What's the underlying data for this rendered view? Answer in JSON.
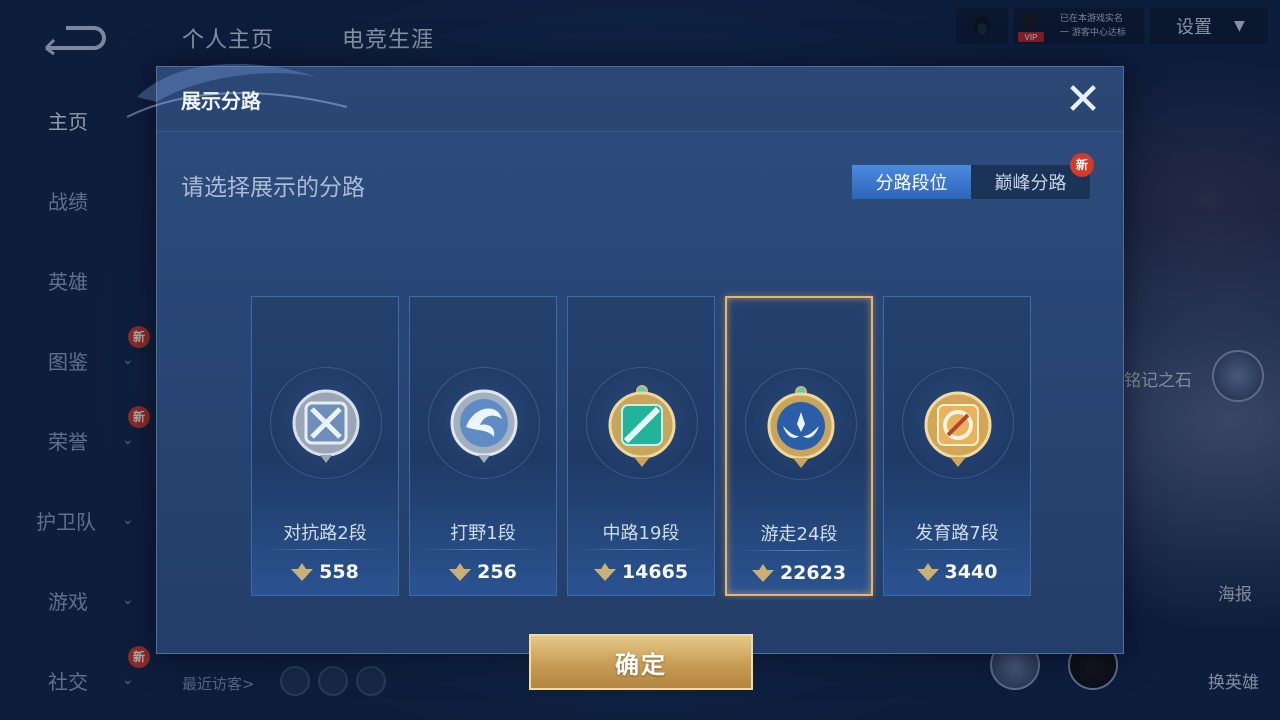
{
  "top_tabs": [
    "个人主页",
    "电竞生涯"
  ],
  "header": {
    "vip_text": "已在本游戏实名\n一 游客中心达标",
    "vip_badge": "VIP",
    "settings_label": "设置"
  },
  "sidebar": {
    "items": [
      {
        "label": "主页",
        "active": true,
        "chevron": false,
        "new": false
      },
      {
        "label": "战绩",
        "active": false,
        "chevron": false,
        "new": false
      },
      {
        "label": "英雄",
        "active": false,
        "chevron": false,
        "new": false
      },
      {
        "label": "图鉴",
        "active": false,
        "chevron": true,
        "new": true
      },
      {
        "label": "荣誉",
        "active": false,
        "chevron": true,
        "new": true
      },
      {
        "label": "护卫队",
        "active": false,
        "chevron": true,
        "new": false
      },
      {
        "label": "游戏",
        "active": false,
        "chevron": true,
        "new": false
      },
      {
        "label": "社交",
        "active": false,
        "chevron": true,
        "new": true
      }
    ],
    "new_badge": "新"
  },
  "right_panel": {
    "stone_label": "铭记之石",
    "poster_label": "海报",
    "switch_hero_label": "换英雄"
  },
  "visitors_label": "最近访客>",
  "dialog": {
    "title": "展示分路",
    "prompt": "请选择展示的分路",
    "toggle": {
      "options": [
        "分路段位",
        "巅峰分路"
      ],
      "active_index": 0,
      "new_badge": "新"
    },
    "cards": [
      {
        "rank": "对抗路2段",
        "score": "558",
        "emblem": "crossed-swords-emblem",
        "selected": false
      },
      {
        "rank": "打野1段",
        "score": "256",
        "emblem": "dragon-emblem",
        "selected": false
      },
      {
        "rank": "中路19段",
        "score": "14665",
        "emblem": "mage-slash-emblem",
        "selected": false
      },
      {
        "rank": "游走24段",
        "score": "22623",
        "emblem": "winged-star-emblem",
        "selected": true
      },
      {
        "rank": "发育路7段",
        "score": "3440",
        "emblem": "marksman-emblem",
        "selected": false
      }
    ],
    "confirm_label": "确定"
  },
  "colors": {
    "accent_blue": "#3d7bd0",
    "gold": "#d4a860",
    "selected_border": "#e8b36a",
    "badge_red": "#d23a2a"
  }
}
